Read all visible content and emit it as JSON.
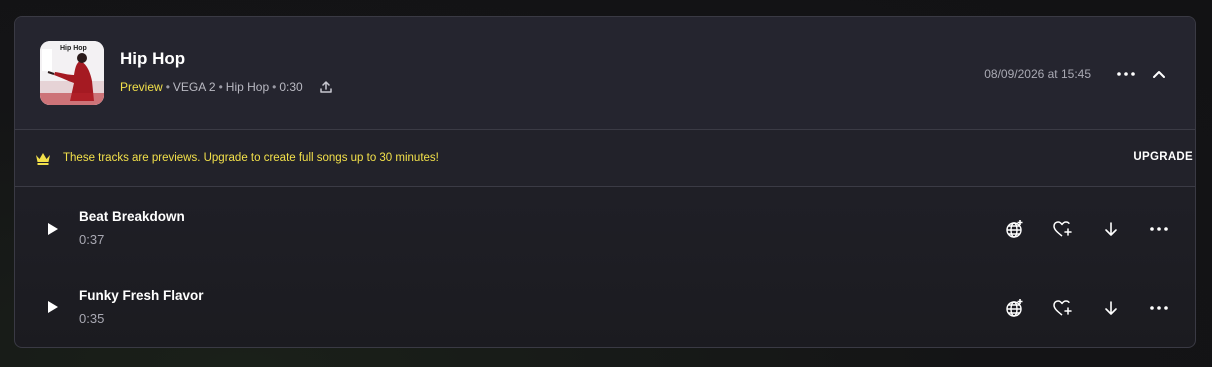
{
  "album": {
    "cover_text": "Hip Hop",
    "title": "Hip Hop",
    "meta": {
      "status": "Preview",
      "model": "VEGA 2",
      "genre": "Hip Hop",
      "duration": "0:30"
    },
    "date": "08/09/2026 at 15:45"
  },
  "banner": {
    "message": "These tracks are previews. Upgrade to create full songs up to 30 minutes!",
    "upgrade_label": "UPGRADE"
  },
  "tracks": [
    {
      "name": "Beat Breakdown",
      "duration": "0:37"
    },
    {
      "name": "Funky Fresh Flavor",
      "duration": "0:35"
    }
  ],
  "icons": {
    "upload": "upload-icon",
    "more": "more-horizontal-icon",
    "collapse": "chevron-up-icon",
    "crown": "crown-icon",
    "play": "play-icon",
    "globe": "globe-icon",
    "heart_add": "heart-plus-icon",
    "download": "arrow-down-icon"
  },
  "colors": {
    "accent_yellow": "#f2e04a",
    "card_bg": "#1f1f26",
    "header_bg": "#25252f"
  }
}
